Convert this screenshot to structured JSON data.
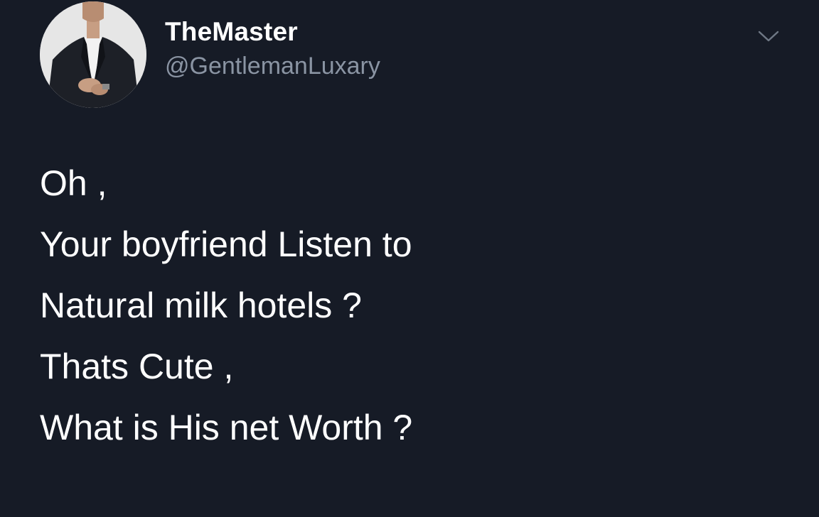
{
  "tweet": {
    "display_name": "TheMaster",
    "handle": "@GentlemanLuxary",
    "lines": [
      "Oh ,",
      "Your boyfriend Listen to",
      "Natural milk hotels ?",
      "Thats Cute ,",
      "What is His net Worth ?"
    ]
  },
  "icons": {
    "avatar": "profile-photo-man-in-suit",
    "menu": "chevron-down-icon"
  },
  "colors": {
    "background": "#161b26",
    "text": "#ffffff",
    "handle": "#8a94a3"
  }
}
